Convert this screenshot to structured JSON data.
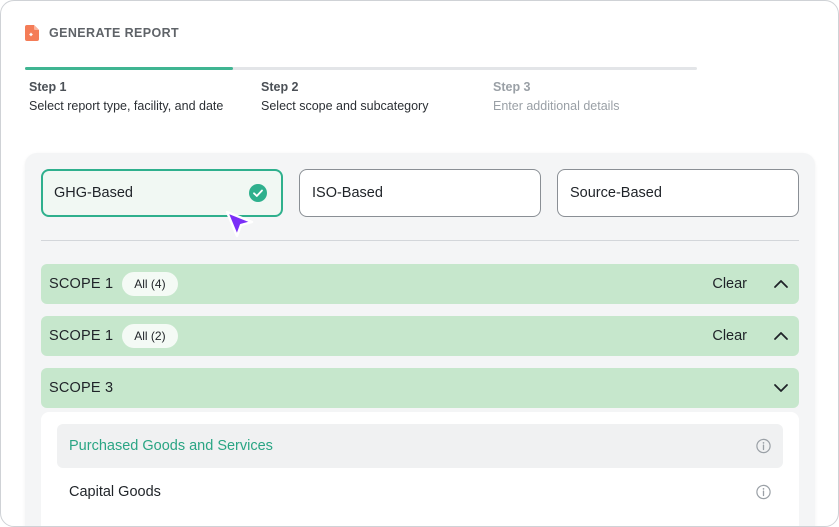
{
  "header": {
    "title": "GENERATE REPORT",
    "icon": "document-icon",
    "icon_color": "#f47c57"
  },
  "stepper": {
    "progress_fraction": 0.31,
    "steps": [
      {
        "label": "Step 1",
        "description": "Select report type, facility, and date",
        "state": "active"
      },
      {
        "label": "Step 2",
        "description": "Select scope and subcategory",
        "state": "active"
      },
      {
        "label": "Step 3",
        "description": "Enter additional details",
        "state": "inactive"
      }
    ]
  },
  "report_types": [
    {
      "label": "GHG-Based",
      "selected": true
    },
    {
      "label": "ISO-Based",
      "selected": false
    },
    {
      "label": "Source-Based",
      "selected": false
    }
  ],
  "scopes": [
    {
      "title": "SCOPE 1",
      "badge": "All (4)",
      "clear_label": "Clear",
      "expanded": true
    },
    {
      "title": "SCOPE 1",
      "badge": "All (2)",
      "clear_label": "Clear",
      "expanded": true
    },
    {
      "title": "SCOPE 3",
      "expanded": false
    }
  ],
  "subcategories": [
    {
      "label": "Purchased Goods and Services",
      "active": true
    },
    {
      "label": "Capital Goods",
      "active": false
    }
  ],
  "colors": {
    "accent": "#2fb08d",
    "scope_bg": "#c6e7cc",
    "cursor": "#7b2ff7"
  }
}
